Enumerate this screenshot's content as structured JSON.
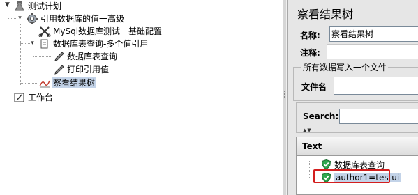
{
  "tree": {
    "nodes": [
      {
        "label": "测试计划",
        "icon": "test-plan-icon"
      },
      {
        "label": "引用数据库的值一高级",
        "icon": "thread-group-gear-icon"
      },
      {
        "label": "MySql数据库测试一基础配置",
        "icon": "config-scissors-icon"
      },
      {
        "label": "数据库表查询-多个值引用",
        "icon": "sampler-db-icon"
      },
      {
        "label": "数据库表查询",
        "icon": "dropper-icon"
      },
      {
        "label": "打印引用值",
        "icon": "dropper-icon"
      },
      {
        "label": "察看结果树",
        "icon": "listener-graph-icon"
      },
      {
        "label": "工作台",
        "icon": "workbench-icon"
      }
    ]
  },
  "panel": {
    "title": "察看结果树",
    "name_label": "名称:",
    "name_value": "察看结果树",
    "comment_label": "注释:",
    "group_title": "所有数据写入一个文件",
    "filename_label": "文件名",
    "search_label": "Search:",
    "results_header": "Text",
    "results": [
      {
        "label": "数据库表查询",
        "status": "success"
      },
      {
        "label": "author1=testui",
        "status": "success"
      }
    ]
  },
  "colors": {
    "selection": "#c3d3e8",
    "highlight_border": "#d31f1f",
    "panel_bg": "#e6e6e6"
  }
}
